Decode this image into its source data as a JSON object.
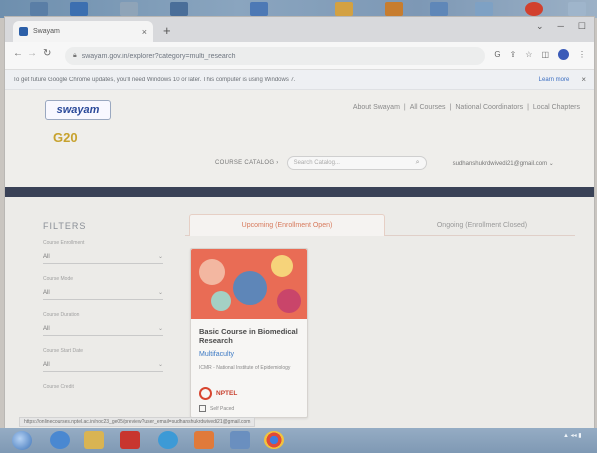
{
  "browser": {
    "tab_title": "Swayam",
    "tab_close": "×",
    "new_tab": "+",
    "window_controls": [
      "⌄",
      "─",
      "☐"
    ],
    "url": "swayam.gov.in/explorer?category=multi_research",
    "infobar_text": "To get future Google Chrome updates, you'll need Windows 10 or later. This computer is using Windows 7.",
    "infobar_link": "Learn more",
    "infobar_close": "×"
  },
  "header": {
    "logo": "swayam",
    "g20": "G20",
    "nav": [
      "About Swayam",
      "|",
      "All Courses",
      "|",
      "National Coordinators",
      "|",
      "Local Chapters"
    ],
    "catalog_label": "COURSE CATALOG ›",
    "search_placeholder": "Search Catalog...",
    "user_email": "sudhanshukrdwivedi21@gmail.com ⌄"
  },
  "filters": {
    "title": "FILTERS",
    "items": [
      {
        "label": "Course Enrollment",
        "value": "All"
      },
      {
        "label": "Course Mode",
        "value": "All"
      },
      {
        "label": "Course Duration",
        "value": "All"
      },
      {
        "label": "Course Start Date",
        "value": "All"
      },
      {
        "label": "Course Credit",
        "value": ""
      }
    ]
  },
  "tabs": {
    "active": "Upcoming (Enrollment Open)",
    "inactive": "Ongoing (Enrollment Closed)"
  },
  "course_card": {
    "title": "Basic Course in Biomedical Research",
    "category": "Multifaculty",
    "institute": "ICMR - National Institute of Epidemiology",
    "provider": "NPTEL",
    "type": "Self Paced"
  },
  "statusbar": "https://onlinecourses.nptel.ac.in/noc23_ge05/preview?user_email=sudhanshukrdwivedi21@gmail.com",
  "colors": {
    "accent": "#d77a5c",
    "link": "#3d7ac4",
    "band": "#3a4257",
    "card_image": "#e96c55"
  }
}
